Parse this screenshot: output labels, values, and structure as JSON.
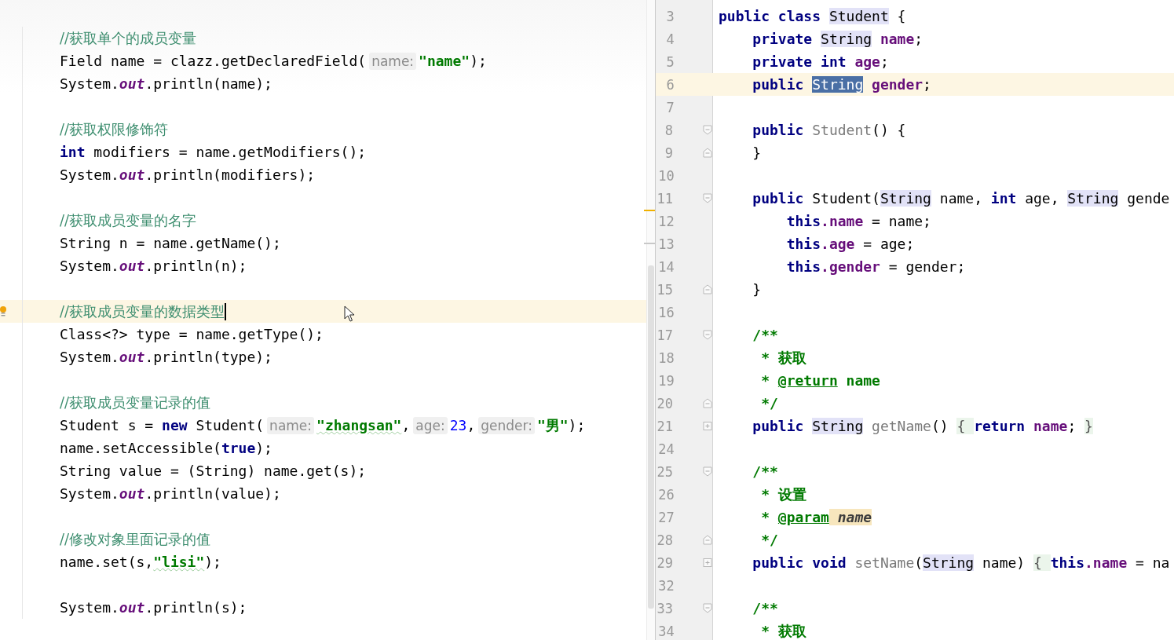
{
  "left_editor": {
    "lines": [
      {
        "current": false,
        "tokens": [
          {
            "text": "//获取单个的成员变量",
            "kind": "comment"
          }
        ]
      },
      {
        "current": false,
        "tokens": [
          {
            "text": "Field name = clazz.getDeclaredField(",
            "kind": "plain"
          },
          {
            "text": "name:",
            "kind": "hint"
          },
          {
            "text": "\"name\"",
            "kind": "string"
          },
          {
            "text": ");",
            "kind": "plain"
          }
        ]
      },
      {
        "current": false,
        "tokens": [
          {
            "text": "System.",
            "kind": "plain"
          },
          {
            "text": "out",
            "kind": "static"
          },
          {
            "text": ".println(name);",
            "kind": "plain"
          }
        ]
      },
      {
        "current": false
      },
      {
        "current": false,
        "tokens": [
          {
            "text": "//获取权限修饰符",
            "kind": "comment"
          }
        ]
      },
      {
        "current": false,
        "tokens": [
          {
            "text": "int",
            "kind": "keyword"
          },
          {
            "text": " modifiers = name.getModifiers();",
            "kind": "plain"
          }
        ]
      },
      {
        "current": false,
        "tokens": [
          {
            "text": "System.",
            "kind": "plain"
          },
          {
            "text": "out",
            "kind": "static"
          },
          {
            "text": ".println(modifiers);",
            "kind": "plain"
          }
        ]
      },
      {
        "current": false
      },
      {
        "current": false,
        "tokens": [
          {
            "text": "//获取成员变量的名字",
            "kind": "comment"
          }
        ]
      },
      {
        "current": false,
        "tokens": [
          {
            "text": "String n = name.getName();",
            "kind": "plain"
          }
        ]
      },
      {
        "current": false,
        "tokens": [
          {
            "text": "System.",
            "kind": "plain"
          },
          {
            "text": "out",
            "kind": "static"
          },
          {
            "text": ".println(n);",
            "kind": "plain"
          }
        ]
      },
      {
        "current": false
      },
      {
        "current": true,
        "tokens": [
          {
            "text": "//获取成员变量的数据类型",
            "kind": "comment"
          }
        ]
      },
      {
        "current": false,
        "tokens": [
          {
            "text": "Class<?> type = name.getType();",
            "kind": "plain"
          }
        ]
      },
      {
        "current": false,
        "tokens": [
          {
            "text": "System.",
            "kind": "plain"
          },
          {
            "text": "out",
            "kind": "static"
          },
          {
            "text": ".println(type);",
            "kind": "plain"
          }
        ]
      },
      {
        "current": false
      },
      {
        "current": false,
        "tokens": [
          {
            "text": "//获取成员变量记录的值",
            "kind": "comment"
          }
        ]
      },
      {
        "current": false,
        "tokens": [
          {
            "text": "Student s = ",
            "kind": "plain"
          },
          {
            "text": "new",
            "kind": "keyword"
          },
          {
            "text": " Student(",
            "kind": "plain"
          },
          {
            "text": "name:",
            "kind": "hint"
          },
          {
            "text": "\"zhangsan\"",
            "kind": "string_typo"
          },
          {
            "text": ",",
            "kind": "plain"
          },
          {
            "text": "age:",
            "kind": "hint"
          },
          {
            "text": "23",
            "kind": "number"
          },
          {
            "text": ",",
            "kind": "plain"
          },
          {
            "text": "gender:",
            "kind": "hint"
          },
          {
            "text": "\"男\"",
            "kind": "string"
          },
          {
            "text": ");",
            "kind": "plain"
          }
        ]
      },
      {
        "current": false,
        "tokens": [
          {
            "text": "name.setAccessible(",
            "kind": "plain"
          },
          {
            "text": "true",
            "kind": "keyword"
          },
          {
            "text": ");",
            "kind": "plain"
          }
        ]
      },
      {
        "current": false,
        "tokens": [
          {
            "text": "String value = (String) name.get(s);",
            "kind": "plain"
          }
        ]
      },
      {
        "current": false,
        "tokens": [
          {
            "text": "System.",
            "kind": "plain"
          },
          {
            "text": "out",
            "kind": "static"
          },
          {
            "text": ".println(value);",
            "kind": "plain"
          }
        ]
      },
      {
        "current": false
      },
      {
        "current": false,
        "tokens": [
          {
            "text": "//修改对象里面记录的值",
            "kind": "comment"
          }
        ]
      },
      {
        "current": false,
        "tokens": [
          {
            "text": "name.set(s,",
            "kind": "plain"
          },
          {
            "text": "\"lisi\"",
            "kind": "string_typo"
          },
          {
            "text": ");",
            "kind": "plain"
          }
        ]
      },
      {
        "current": false
      },
      {
        "current": false,
        "tokens": [
          {
            "text": "System.",
            "kind": "plain"
          },
          {
            "text": "out",
            "kind": "static"
          },
          {
            "text": ".println(s);",
            "kind": "plain"
          }
        ]
      }
    ]
  },
  "right_editor": {
    "lines": [
      {
        "number": "3",
        "current": false,
        "tokens": [
          {
            "text": "public class ",
            "kind": "keyword"
          },
          {
            "text": "Student",
            "kind": "usage"
          },
          {
            "text": " {",
            "kind": "plain"
          }
        ]
      },
      {
        "number": "4",
        "current": false,
        "tokens": [
          {
            "text": "    private ",
            "kind": "keyword"
          },
          {
            "text": "String",
            "kind": "usage"
          },
          {
            "text": " name",
            "kind": "field"
          },
          {
            "text": ";",
            "kind": "plain"
          }
        ]
      },
      {
        "number": "5",
        "current": false,
        "tokens": [
          {
            "text": "    private int ",
            "kind": "keyword"
          },
          {
            "text": "age",
            "kind": "field"
          },
          {
            "text": ";",
            "kind": "plain"
          }
        ]
      },
      {
        "number": "6",
        "current": true,
        "tokens": [
          {
            "text": "    public ",
            "kind": "keyword"
          },
          {
            "text": "String",
            "kind": "selected"
          },
          {
            "text": " gender",
            "kind": "field"
          },
          {
            "text": ";",
            "kind": "plain"
          }
        ]
      },
      {
        "number": "7",
        "current": false
      },
      {
        "number": "8",
        "current": false,
        "kind": "fold_start",
        "tokens": [
          {
            "text": "    public ",
            "kind": "keyword"
          },
          {
            "text": "Student",
            "kind": "unused"
          },
          {
            "text": "() {",
            "kind": "plain"
          }
        ]
      },
      {
        "number": "9",
        "current": false,
        "kind": "fold_end",
        "tokens": [
          {
            "text": "    }",
            "kind": "plain"
          }
        ]
      },
      {
        "number": "10",
        "current": false
      },
      {
        "number": "11",
        "current": false,
        "kind": "fold_start",
        "tokens": [
          {
            "text": "    public ",
            "kind": "keyword"
          },
          {
            "text": "Student(",
            "kind": "plain"
          },
          {
            "text": "String",
            "kind": "usage"
          },
          {
            "text": " name, ",
            "kind": "plain"
          },
          {
            "text": "int",
            "kind": "keyword"
          },
          {
            "text": " age, ",
            "kind": "plain"
          },
          {
            "text": "String",
            "kind": "usage"
          },
          {
            "text": " gende",
            "kind": "plain"
          }
        ]
      },
      {
        "number": "12",
        "current": false,
        "tokens": [
          {
            "text": "        this",
            "kind": "keyword"
          },
          {
            "text": ".name",
            "kind": "field"
          },
          {
            "text": " = name;",
            "kind": "plain"
          }
        ]
      },
      {
        "number": "13",
        "current": false,
        "tokens": [
          {
            "text": "        this",
            "kind": "keyword"
          },
          {
            "text": ".age",
            "kind": "field"
          },
          {
            "text": " = age;",
            "kind": "plain"
          }
        ]
      },
      {
        "number": "14",
        "current": false,
        "tokens": [
          {
            "text": "        this",
            "kind": "keyword"
          },
          {
            "text": ".gender",
            "kind": "field"
          },
          {
            "text": " = gender;",
            "kind": "plain"
          }
        ]
      },
      {
        "number": "15",
        "current": false,
        "kind": "fold_end",
        "tokens": [
          {
            "text": "    }",
            "kind": "plain"
          }
        ]
      },
      {
        "number": "16",
        "current": false
      },
      {
        "number": "17",
        "current": false,
        "kind": "fold_start",
        "tokens": [
          {
            "text": "    /**",
            "kind": "doc"
          }
        ]
      },
      {
        "number": "18",
        "current": false,
        "tokens": [
          {
            "text": "     * 获取",
            "kind": "doc"
          }
        ]
      },
      {
        "number": "19",
        "current": false,
        "tokens": [
          {
            "text": "     * ",
            "kind": "doc"
          },
          {
            "text": "@return",
            "kind": "doctag"
          },
          {
            "text": " name",
            "kind": "doc"
          }
        ]
      },
      {
        "number": "20",
        "current": false,
        "kind": "fold_end",
        "tokens": [
          {
            "text": "     */",
            "kind": "doc"
          }
        ]
      },
      {
        "number": "21",
        "current": false,
        "kind": "folded",
        "tokens": [
          {
            "text": "    public ",
            "kind": "keyword"
          },
          {
            "text": "String",
            "kind": "usage"
          },
          {
            "text": " getName",
            "kind": "unused"
          },
          {
            "text": "() ",
            "kind": "plain"
          },
          {
            "text": "{ ",
            "kind": "folded"
          },
          {
            "text": "return ",
            "kind": "keyword"
          },
          {
            "text": "name",
            "kind": "field"
          },
          {
            "text": "; ",
            "kind": "plain"
          },
          {
            "text": "}",
            "kind": "folded"
          }
        ]
      },
      {
        "number": "24",
        "current": false
      },
      {
        "number": "25",
        "current": false,
        "kind": "fold_start",
        "tokens": [
          {
            "text": "    /**",
            "kind": "doc"
          }
        ]
      },
      {
        "number": "26",
        "current": false,
        "tokens": [
          {
            "text": "     * 设置",
            "kind": "doc"
          }
        ]
      },
      {
        "number": "27",
        "current": false,
        "tokens": [
          {
            "text": "     * ",
            "kind": "doc"
          },
          {
            "text": "@param",
            "kind": "doctag"
          },
          {
            "text": " name",
            "kind": "param"
          }
        ]
      },
      {
        "number": "28",
        "current": false,
        "kind": "fold_end",
        "tokens": [
          {
            "text": "     */",
            "kind": "doc"
          }
        ]
      },
      {
        "number": "29",
        "current": false,
        "kind": "folded",
        "tokens": [
          {
            "text": "    public void ",
            "kind": "keyword"
          },
          {
            "text": "setName",
            "kind": "unused"
          },
          {
            "text": "(",
            "kind": "plain"
          },
          {
            "text": "String",
            "kind": "usage"
          },
          {
            "text": " name) ",
            "kind": "plain"
          },
          {
            "text": "{ ",
            "kind": "folded"
          },
          {
            "text": "this",
            "kind": "keyword"
          },
          {
            "text": ".name",
            "kind": "field"
          },
          {
            "text": " = na",
            "kind": "plain"
          }
        ]
      },
      {
        "number": "32",
        "current": false
      },
      {
        "number": "33",
        "current": false,
        "kind": "fold_start",
        "tokens": [
          {
            "text": "    /**",
            "kind": "doc"
          }
        ]
      },
      {
        "number": "34",
        "current": false,
        "tokens": [
          {
            "text": "     * 获取",
            "kind": "doc"
          }
        ]
      }
    ]
  }
}
